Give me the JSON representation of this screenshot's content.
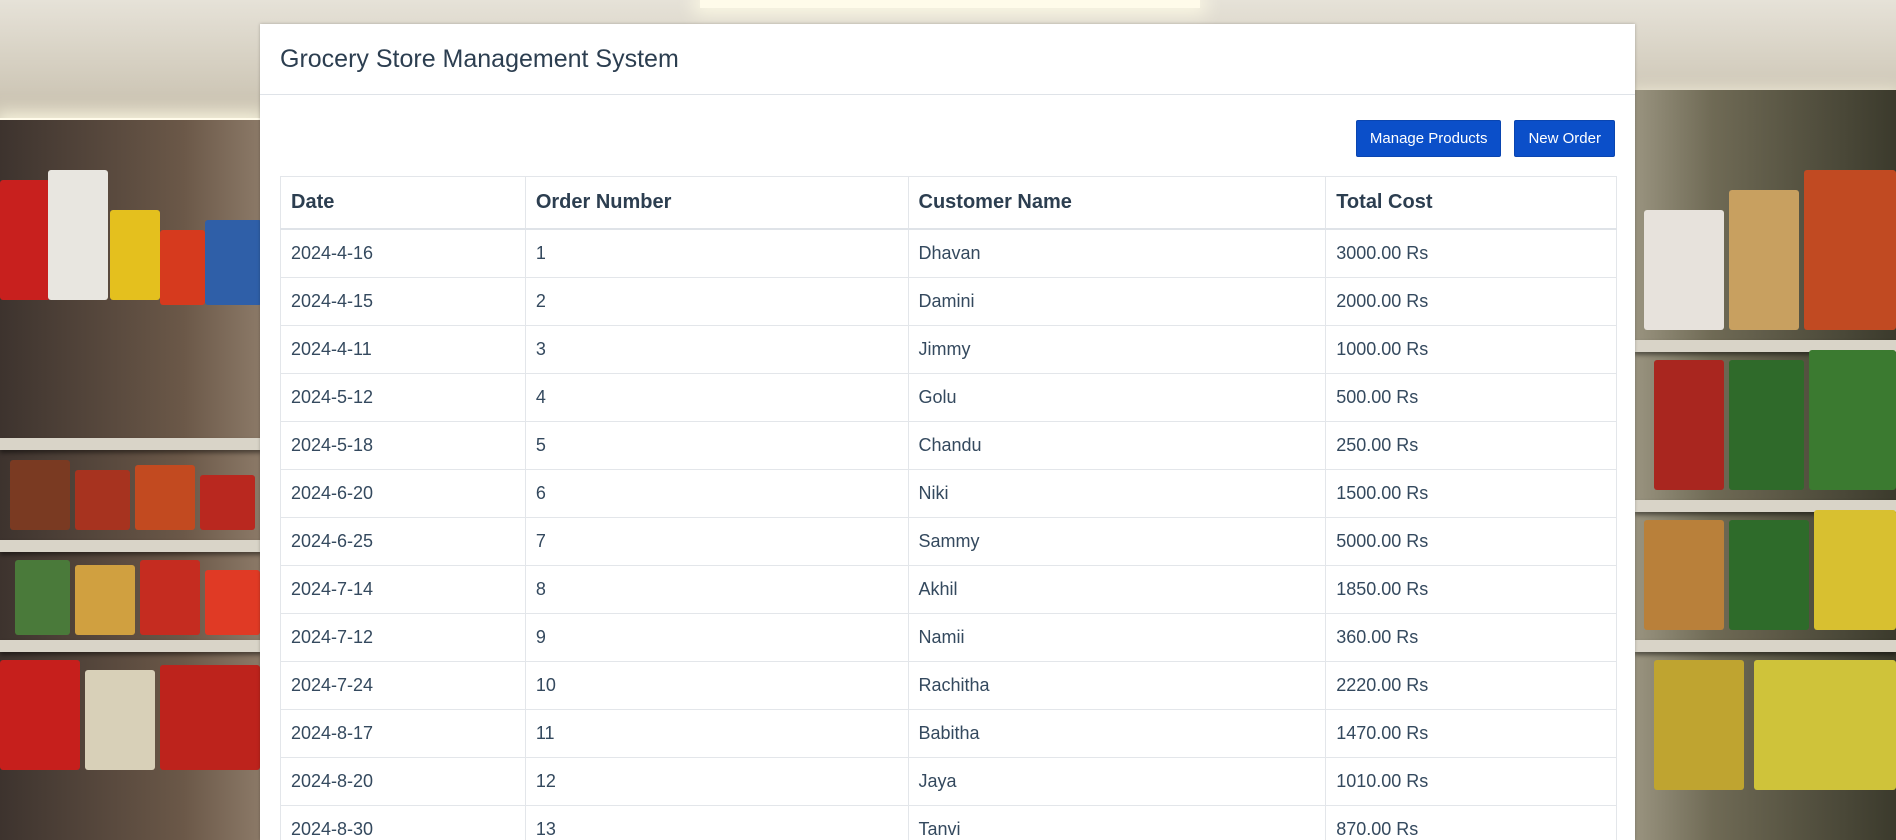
{
  "app": {
    "title": "Grocery Store Management System"
  },
  "toolbar": {
    "manage_products_label": "Manage Products",
    "new_order_label": "New Order",
    "button_color": "#0b4fc9"
  },
  "orders_table": {
    "columns": [
      "Date",
      "Order Number",
      "Customer Name",
      "Total Cost"
    ],
    "rows": [
      [
        "2024-4-16",
        "1",
        "Dhavan",
        "3000.00 Rs"
      ],
      [
        "2024-4-15",
        "2",
        "Damini",
        "2000.00 Rs"
      ],
      [
        "2024-4-11",
        "3",
        "Jimmy",
        "1000.00 Rs"
      ],
      [
        "2024-5-12",
        "4",
        "Golu",
        "500.00 Rs"
      ],
      [
        "2024-5-18",
        "5",
        "Chandu",
        "250.00 Rs"
      ],
      [
        "2024-6-20",
        "6",
        "Niki",
        "1500.00 Rs"
      ],
      [
        "2024-6-25",
        "7",
        "Sammy",
        "5000.00 Rs"
      ],
      [
        "2024-7-14",
        "8",
        "Akhil",
        "1850.00 Rs"
      ],
      [
        "2024-7-12",
        "9",
        "Namii",
        "360.00 Rs"
      ],
      [
        "2024-7-24",
        "10",
        "Rachitha",
        "2220.00 Rs"
      ],
      [
        "2024-8-17",
        "11",
        "Babitha",
        "1470.00 Rs"
      ],
      [
        "2024-8-20",
        "12",
        "Jaya",
        "1010.00 Rs"
      ],
      [
        "2024-8-30",
        "13",
        "Tanvi",
        "870.00 Rs"
      ]
    ]
  },
  "background": {
    "description_icon": "supermarket-aisle-photo"
  }
}
